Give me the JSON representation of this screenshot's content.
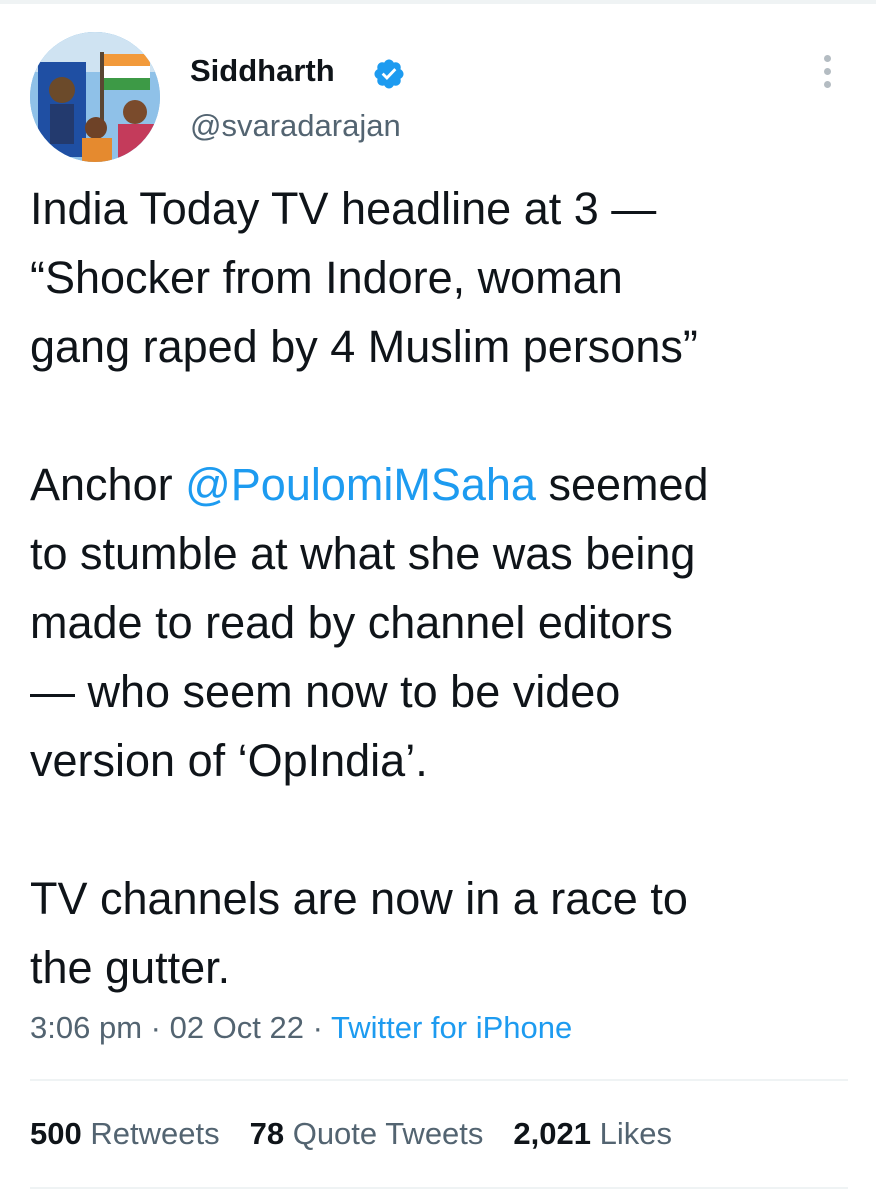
{
  "author": {
    "name": "Siddharth",
    "handle": "@svaradarajan",
    "verified": true,
    "avatar_icon": "profile-photo-icon"
  },
  "tweet": {
    "paragraph1": [
      "India Today TV headline at 3 —",
      "“Shocker from Indore, woman",
      "gang raped by 4 Muslim persons”"
    ],
    "paragraph2": {
      "line1_prefix": "Anchor ",
      "mention": "@PoulomiMSaha",
      "line1_suffix": " seemed",
      "lines": [
        "to stumble at what she was being",
        "made to read by channel editors",
        "— who seem now to be video",
        "version of ‘OpIndia’."
      ]
    },
    "paragraph3": [
      "TV channels are now in a race to",
      "the gutter."
    ]
  },
  "meta": {
    "time": "3:06 pm",
    "separator": " · ",
    "date": "02 Oct 22",
    "source": "Twitter for iPhone"
  },
  "stats": {
    "retweets_count": "500",
    "retweets_label": "Retweets",
    "quotes_count": "78",
    "quotes_label": "Quote Tweets",
    "likes_count": "2,021",
    "likes_label": "Likes"
  },
  "colors": {
    "link": "#1d9bf0",
    "secondary_text": "#536471",
    "primary_text": "#0f1419",
    "divider": "#eff3f4"
  }
}
